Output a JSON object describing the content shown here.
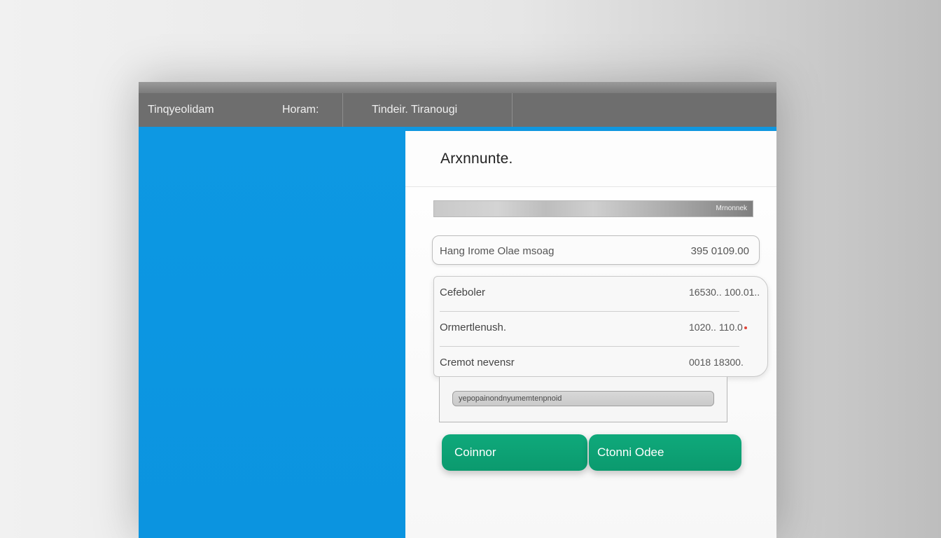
{
  "nav": {
    "items": [
      {
        "label": "Tinqyeolidam"
      },
      {
        "label": "Horam:"
      },
      {
        "label": "Tindeir.  Tiranougi"
      }
    ]
  },
  "panel": {
    "title": "Arxnnunte.",
    "progress": {
      "label": "Mrnonnek"
    },
    "field": {
      "label": "Hang Irome Olae msoag",
      "value": "395 0109.00"
    },
    "list": [
      {
        "label": "Cefeboler",
        "value": "16530.. 100.01.."
      },
      {
        "label": "Ormertlenush.",
        "value": "1020.. 110.0"
      },
      {
        "label": "Cremot nevensr",
        "value": "0018 18300."
      }
    ],
    "search_text": "yepopainondnyumemtenpnoid"
  },
  "buttons": {
    "primary": "Coinnor",
    "secondary": "Ctonni Odee"
  },
  "colors": {
    "accent_blue": "#0d98e3",
    "button_green": "#0fa97b",
    "nav_bg": "#6e6e6e",
    "alert_red": "#e0463a"
  }
}
